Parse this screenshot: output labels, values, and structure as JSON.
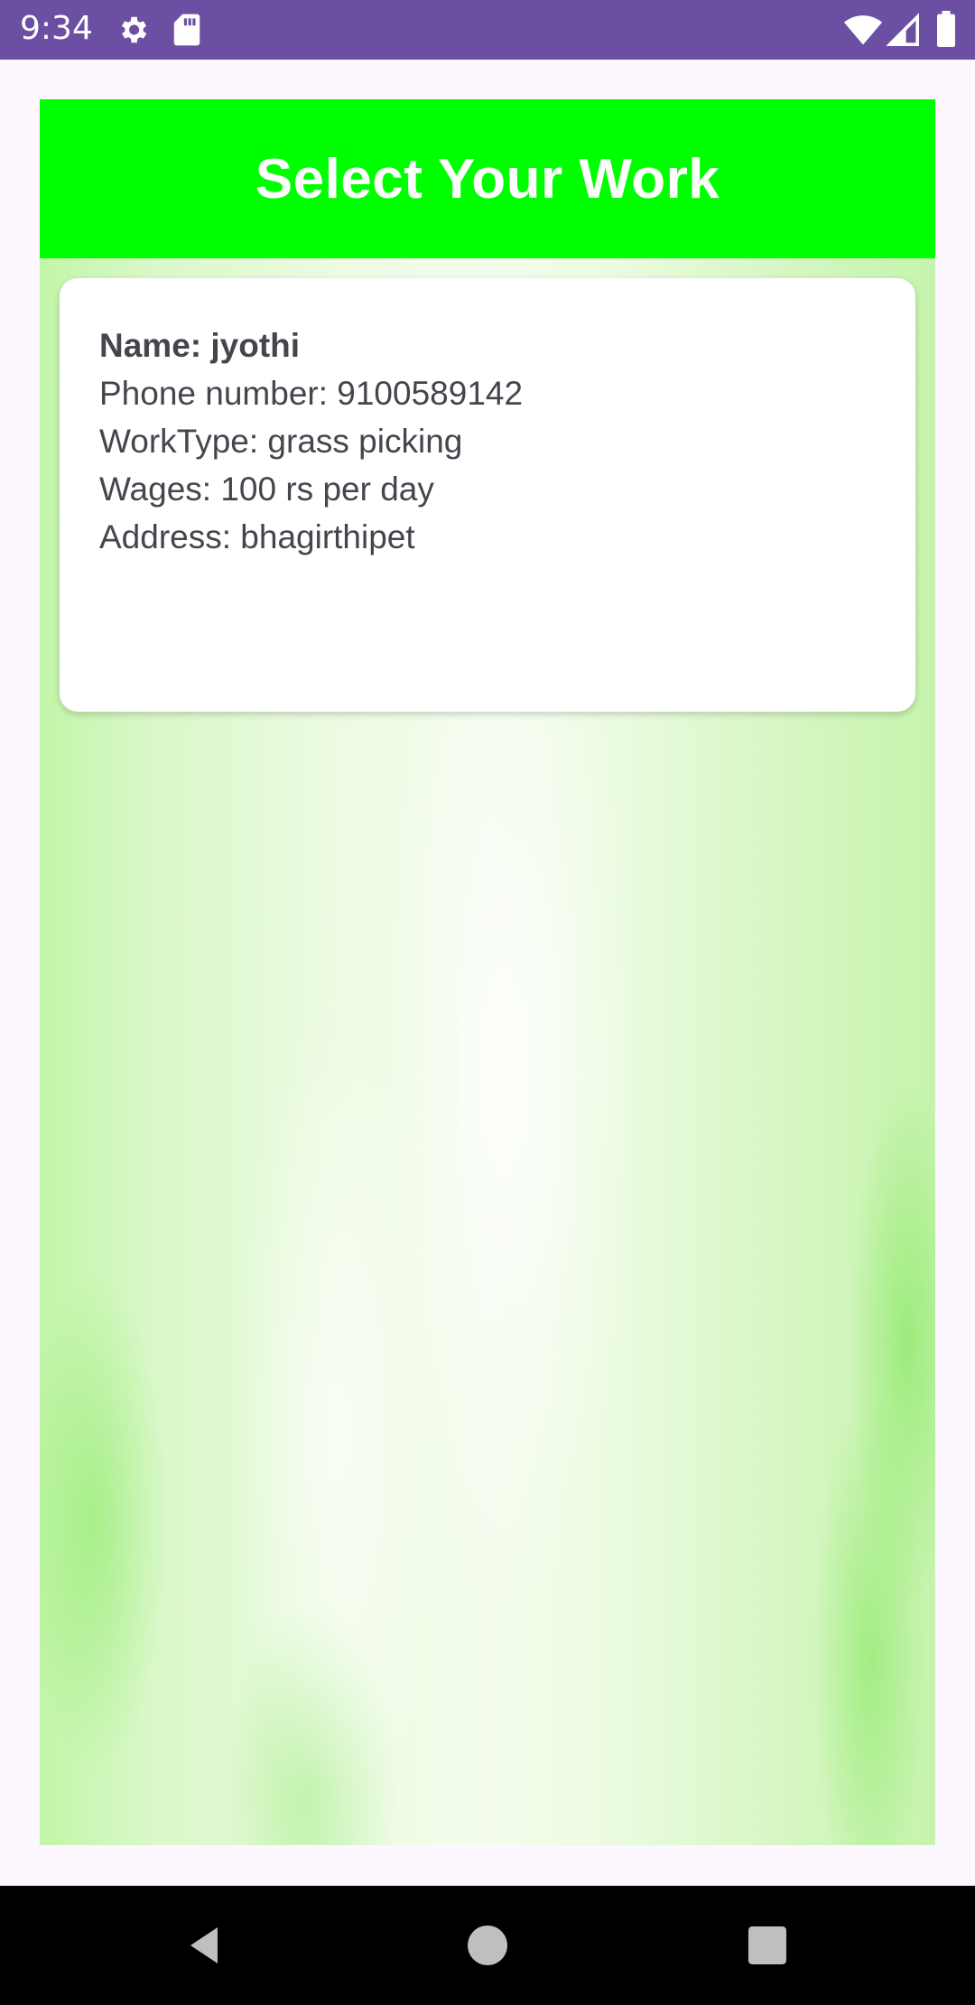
{
  "status_bar": {
    "time": "9:34",
    "icons": [
      "settings-icon",
      "sd-card-icon",
      "wifi-icon",
      "cell-signal-icon",
      "battery-icon"
    ]
  },
  "header": {
    "title": "Select Your Work",
    "color": "#00ff00"
  },
  "worker_card": {
    "name": "Name: jyothi",
    "phone": "Phone number: 9100589142",
    "work_type": "WorkType: grass picking",
    "wages": "Wages: 100 rs per day",
    "address": "Address: bhagirthipet"
  },
  "nav_bar": {
    "icons": [
      "back-icon",
      "home-icon",
      "recents-icon"
    ]
  },
  "colors": {
    "status_bar": "#6a4fa3",
    "header": "#00ff00",
    "card_text": "#45454d"
  }
}
